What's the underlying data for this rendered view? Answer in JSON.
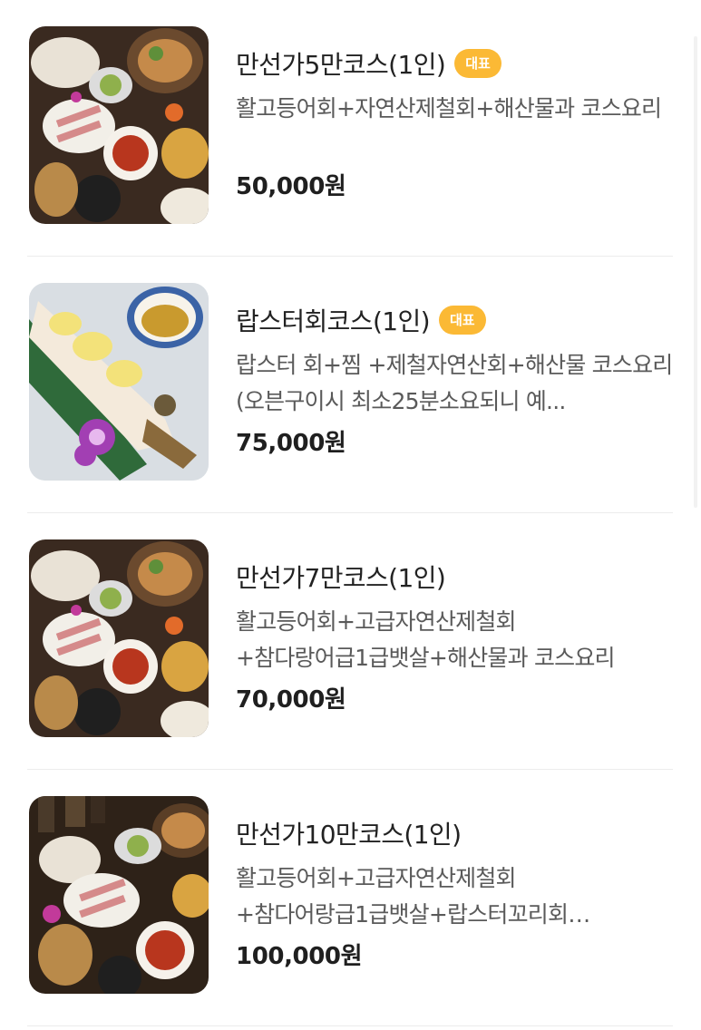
{
  "menu": {
    "items": [
      {
        "title": "만선가5만코스(1인)",
        "badge": "대표",
        "description": "활고등어회+자연산제철회+해산물과 코스요리",
        "price": "50,000원"
      },
      {
        "title": "랍스터회코스(1인)",
        "badge": "대표",
        "description": "랍스터 회+찜 +제철자연산회+해산물 코스요리 (오븐구이시 최소25분소요되니 예...",
        "price": "75,000원"
      },
      {
        "title": "만선가7만코스(1인)",
        "description": "활고등어회+고급자연산제철회+참다랑어급1급뱃살+해산물과 코스요리",
        "price": "70,000원"
      },
      {
        "title": "만선가10만코스(1인)",
        "description": "활고등어회+고급자연산제철회+참다어랑급1급뱃살+랍스터꼬리회+찜해산물과 코...",
        "price": "100,000원"
      }
    ]
  },
  "colors": {
    "badge": "#fbb935",
    "title": "#222222",
    "description": "#5a5a5a",
    "divider": "#ececec"
  }
}
